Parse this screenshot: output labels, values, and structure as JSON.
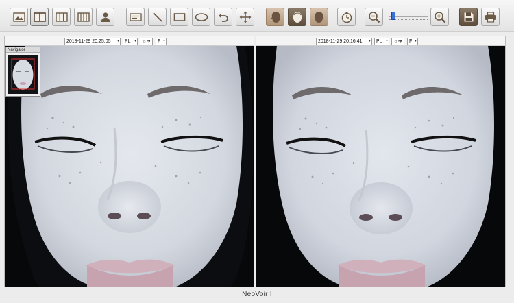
{
  "toolbar": {
    "buttons": [
      {
        "name": "single-view-button",
        "icon": "image-icon"
      },
      {
        "name": "split-view-button",
        "icon": "two-pane-icon"
      },
      {
        "name": "triple-view-button",
        "icon": "three-pane-icon"
      },
      {
        "name": "quad-view-button",
        "icon": "four-pane-icon"
      },
      {
        "name": "patient-button",
        "icon": "person-icon"
      },
      {
        "name": "text-tool-button",
        "icon": "text-box-icon"
      },
      {
        "name": "line-tool-button",
        "icon": "line-icon"
      },
      {
        "name": "rectangle-tool-button",
        "icon": "rectangle-icon"
      },
      {
        "name": "ellipse-tool-button",
        "icon": "ellipse-icon"
      },
      {
        "name": "undo-button",
        "icon": "undo-icon"
      },
      {
        "name": "move-button",
        "icon": "move-icon"
      },
      {
        "name": "left-profile-button",
        "icon": "face-left-icon"
      },
      {
        "name": "front-face-button",
        "icon": "face-front-icon"
      },
      {
        "name": "right-profile-button",
        "icon": "face-right-icon"
      },
      {
        "name": "timer-button",
        "icon": "stopwatch-icon"
      },
      {
        "name": "zoom-out-button",
        "icon": "zoom-out-icon"
      },
      {
        "name": "zoom-in-button",
        "icon": "zoom-in-icon"
      },
      {
        "name": "save-button",
        "icon": "save-icon"
      },
      {
        "name": "print-button",
        "icon": "printer-icon"
      }
    ],
    "zoom_level": 0.1
  },
  "panels": {
    "left": {
      "datetime": "2018-11-29 20:25:05",
      "mode": "PL",
      "light": "☼➔",
      "channel": "F"
    },
    "right": {
      "datetime": "2018-11-29 20:16:41",
      "mode": "PL",
      "light": "☼➔",
      "channel": "F"
    }
  },
  "navigator": {
    "title": "Navigator"
  },
  "footer": {
    "product_name": "NeoVoir I"
  },
  "colors": {
    "accent": "#3c6fd6",
    "active_button": "#5e4d3c",
    "face_tone": "#d9dde3"
  }
}
